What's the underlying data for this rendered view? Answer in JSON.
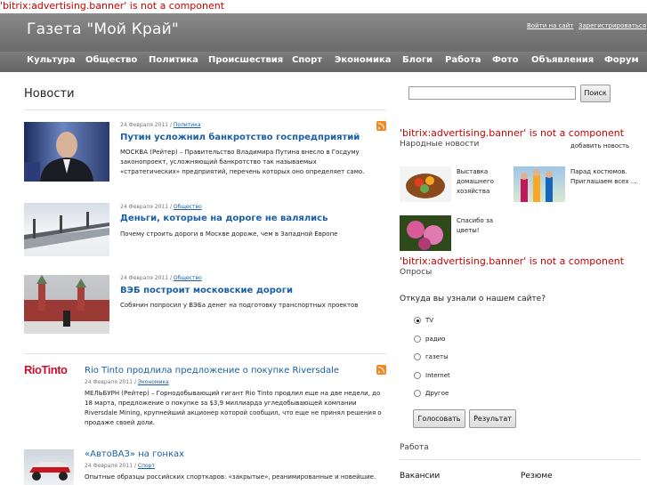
{
  "errors": {
    "top": "'bitrix:advertising.banner' is not a component",
    "side1": "'bitrix:advertising.banner' is not a component",
    "side2": "'bitrix:advertising.banner' is not a component"
  },
  "header": {
    "title": "Газета \"Мой Край\"",
    "login": "Войти на сайт",
    "register": "Зарегистрироваться"
  },
  "nav": [
    "Культура",
    "Общество",
    "Политика",
    "Происшествия",
    "Спорт",
    "Экономика",
    "Блоги",
    "Работа",
    "Фото",
    "Объявления",
    "Форум"
  ],
  "content": {
    "title": "Новости",
    "news": [
      {
        "date": "24 Февраля 2011",
        "category": "Политика",
        "title": "Путин усложнил банкротство госпредприятий",
        "text": "МОСКВА (Рейтер) – Правительство Владимира Путина внесло в Госдуму законопроект, усложняющий банкротство так называемых «стратегических» предприятий, перечень которых оно определяет само."
      },
      {
        "date": "24 Февраля 2011",
        "category": "Общество",
        "title": "Деньги, которые на дороге не валялись",
        "text": "Почему строить дороги в Москве дороже, чем в Западной Европе"
      },
      {
        "date": "24 Февраля 2011",
        "category": "Общество",
        "title": "ВЭБ построит московские дороги",
        "text": "Собянин попросил у ВЭБа денег на подготовку транспортных проектов"
      }
    ],
    "economy": [
      {
        "logo": "RioTinto",
        "title": "Rio Tinto продлила предложение о покупке Riversdale",
        "date": "24 Февраля 2011",
        "category": "Экономика",
        "text": "МЕЛЬБУРН (Рейтер) – Горнодобывающий гигант Rio Tinto продлил еще на две недели, до 18 марта, предложение о покупке за $3,9 миллиарда угледобывающей компании Riversdale Mining, крупнейший акционер которой сообщил, что еще не принял решения о продаже своей доли."
      },
      {
        "title": "«АвтоВАЗ» на гонках",
        "date": "24 Февраля 2011",
        "category": "Спорт",
        "text": "Опытные образцы российских спорткаров: «закрытые», реанимированные и новейшие."
      }
    ]
  },
  "sidebar": {
    "search_button": "Поиск",
    "people_news": {
      "title": "Народные новости",
      "add_link": "добавить новость",
      "items": [
        "Выставка домашнего хозяйства",
        "Парад костюмов. Приглашаем всех ...",
        "Спасибо за цветы!"
      ]
    },
    "poll": {
      "title": "Опросы",
      "question": "Откуда вы узнали о нашем сайте?",
      "options": [
        "TV",
        "радио",
        "газеты",
        "Internet",
        "Другое"
      ],
      "selected": 0,
      "vote_button": "Голосовать",
      "result_button": "Результат"
    },
    "jobs": {
      "title": "Работа",
      "vacancies": "Вакансии",
      "resumes": "Резюме"
    }
  },
  "colors": {
    "link": "#1a5fa6",
    "error": "#cc0000",
    "header": "#777777",
    "rss": "#f08a24"
  }
}
